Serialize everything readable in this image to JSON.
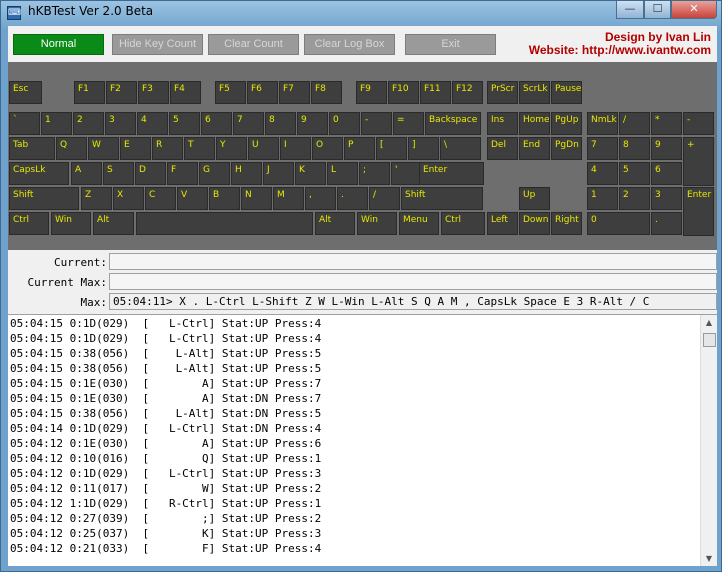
{
  "window": {
    "title": "hKBTest Ver 2.0 Beta",
    "minimize": "—",
    "maximize": "☐",
    "close": "✕",
    "icon": "keyboard-icon"
  },
  "buttons": {
    "normal": "Normal",
    "hide_key_count": "Hide Key Count",
    "clear_count": "Clear Count",
    "clear_log_box": "Clear Log Box",
    "exit": "Exit"
  },
  "credits": {
    "designer": "Design by Ivan Lin",
    "website": "Website: http://www.ivantw.com"
  },
  "keyboard": {
    "function_row": [
      "Esc",
      "F1",
      "F2",
      "F3",
      "F4",
      "F5",
      "F6",
      "F7",
      "F8",
      "F9",
      "F10",
      "F11",
      "F12",
      "PrScr",
      "ScrLk",
      "Pause"
    ],
    "number_row": [
      "`",
      "1",
      "2",
      "3",
      "4",
      "5",
      "6",
      "7",
      "8",
      "9",
      "0",
      "-",
      "=",
      "Backspace",
      "Ins",
      "Home",
      "PgUp",
      "NmLk",
      "/",
      "*",
      "-"
    ],
    "tab_row": [
      "Tab",
      "Q",
      "W",
      "E",
      "R",
      "T",
      "Y",
      "U",
      "I",
      "O",
      "P",
      "[",
      "]",
      "\\",
      "Del",
      "End",
      "PgDn",
      "7",
      "8",
      "9",
      "+"
    ],
    "caps_row": [
      "CapsLk",
      "A",
      "S",
      "D",
      "F",
      "G",
      "H",
      "J",
      "K",
      "L",
      ";",
      "'",
      "Enter",
      "4",
      "5",
      "6"
    ],
    "shift_row": [
      "Shift",
      "Z",
      "X",
      "C",
      "V",
      "B",
      "N",
      "M",
      ",",
      ".",
      "/",
      "Shift",
      "Up",
      "1",
      "2",
      "3",
      "Enter"
    ],
    "ctrl_row": [
      "Ctrl",
      "Win",
      "Alt",
      "",
      "Alt",
      "Win",
      "Menu",
      "Ctrl",
      "Left",
      "Down",
      "Right",
      "0",
      "."
    ]
  },
  "status": {
    "current_label": "Current:",
    "current_value": "",
    "current_max_label": "Current Max:",
    "current_max_value": "",
    "max_label": "Max:",
    "max_value": "05:04:11> X . L-Ctrl L-Shift Z W L-Win L-Alt S Q A M , CapsLk Space E 3 R-Alt / C"
  },
  "log": [
    "05:04:15 0:1D(029)  [   L-Ctrl] Stat:UP Press:4",
    "05:04:15 0:1D(029)  [   L-Ctrl] Stat:UP Press:4",
    "05:04:15 0:38(056)  [    L-Alt] Stat:UP Press:5",
    "05:04:15 0:38(056)  [    L-Alt] Stat:UP Press:5",
    "05:04:15 0:1E(030)  [        A] Stat:UP Press:7",
    "05:04:15 0:1E(030)  [        A] Stat:DN Press:7",
    "05:04:15 0:38(056)  [    L-Alt] Stat:DN Press:5",
    "05:04:14 0:1D(029)  [   L-Ctrl] Stat:DN Press:4",
    "05:04:12 0:1E(030)  [        A] Stat:UP Press:6",
    "05:04:12 0:10(016)  [        Q] Stat:UP Press:1",
    "05:04:12 0:1D(029)  [   L-Ctrl] Stat:UP Press:3",
    "05:04:12 0:11(017)  [        W] Stat:UP Press:2",
    "05:04:12 1:1D(029)  [   R-Ctrl] Stat:UP Press:1",
    "05:04:12 0:27(039)  [        ;] Stat:UP Press:2",
    "05:04:12 0:25(037)  [        K] Stat:UP Press:3",
    "05:04:12 0:21(033)  [        F] Stat:UP Press:4"
  ]
}
